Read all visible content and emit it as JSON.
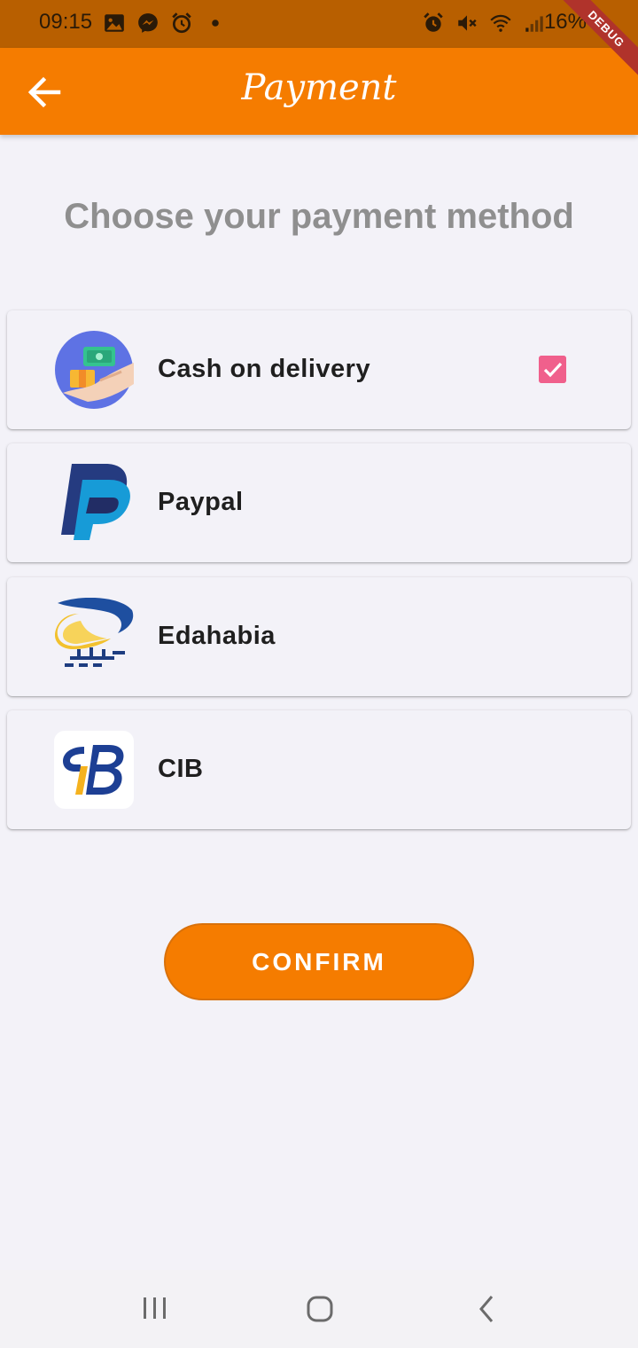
{
  "status_bar": {
    "time": "09:15",
    "battery": "16%",
    "left_icons": [
      "gallery-icon",
      "messenger-icon",
      "alarm-icon",
      "dot-icon"
    ],
    "right_icons": [
      "alarm-icon",
      "mute-icon",
      "wifi-icon",
      "signal-icon"
    ]
  },
  "debug_banner": "DEBUG",
  "app_bar": {
    "title": "Payment",
    "back_icon": "arrow-back-icon",
    "color": "#f57c00"
  },
  "heading": "Choose your payment method",
  "payment_methods": [
    {
      "label": "Cash on delivery",
      "icon": "cash-delivery-icon",
      "selected": true
    },
    {
      "label": "Paypal",
      "icon": "paypal-icon",
      "selected": false
    },
    {
      "label": "Edahabia",
      "icon": "edahabia-icon",
      "selected": false
    },
    {
      "label": "CIB",
      "icon": "cib-icon",
      "selected": false
    }
  ],
  "confirm_button": {
    "label": "CONFIRM",
    "color": "#f57c00"
  },
  "checkbox_color": "#f0608c",
  "nav_bar": {
    "icons": [
      "recents-icon",
      "home-icon",
      "nav-back-icon"
    ]
  }
}
